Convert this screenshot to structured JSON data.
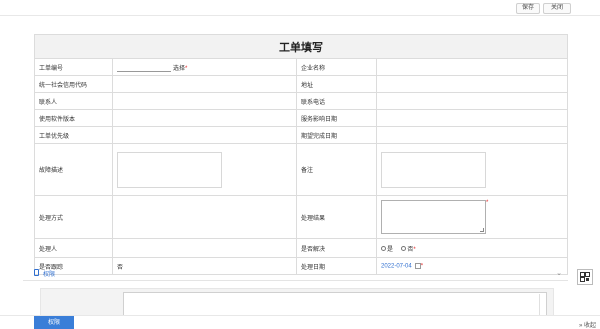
{
  "toolbar": {
    "save_label": "保存",
    "close_label": "关闭"
  },
  "form": {
    "title": "工单填写",
    "fields": {
      "ticket_no": "工单编号",
      "select_link": "选择",
      "company_name": "企业名称",
      "credit_code": "统一社会信用代码",
      "address": "地址",
      "contact": "联系人",
      "phone": "联系电话",
      "software_version": "使用软件版本",
      "service_date": "服务影响日期",
      "priority": "工单优先级",
      "expected_date": "期望完成日期",
      "fault_desc": "故障描述",
      "remark": "备注",
      "handling_method": "处理方式",
      "handling_result": "处理结果",
      "handler": "处理人",
      "resolved": "是否解决",
      "resolved_yes": "是",
      "resolved_no": "否",
      "followup": "是否跟踪",
      "followup_value": "否",
      "handle_date": "处理日期",
      "handle_date_value": "2022-07-04"
    },
    "required_mark": "*"
  },
  "permissions": {
    "section_title": "权限",
    "button_label": "权限"
  },
  "footer": {
    "collapse_label": "收起"
  },
  "colors": {
    "accent": "#3a7ed8",
    "required": "#e02020"
  },
  "icons": [
    "doc-icon",
    "chevron-down-icon",
    "qr-code-icon",
    "calendar-icon",
    "double-chevron-right-icon"
  ]
}
